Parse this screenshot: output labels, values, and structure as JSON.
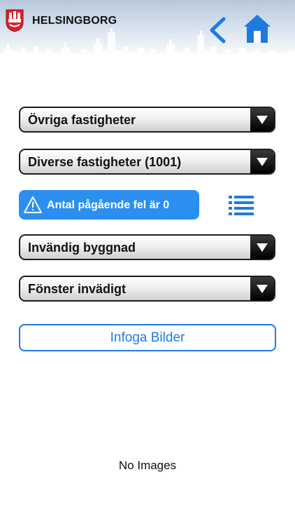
{
  "header": {
    "title": "HELSINGBORG",
    "back_icon": "chevron-left-icon",
    "home_icon": "home-icon",
    "accent_color": "#1f7ae0"
  },
  "selects": [
    {
      "label": "Övriga fastigheter"
    },
    {
      "label": "Diverse fastigheter (1001)"
    },
    {
      "label": "Invändig byggnad"
    },
    {
      "label": "Fönster invädigt"
    }
  ],
  "alert": {
    "text": "Antal pågående fel är 0",
    "icon": "warning-icon",
    "color": "#2b8ff0"
  },
  "list_icon": "list-icon",
  "insert_button": {
    "label": "Infoga Bilder"
  },
  "status": {
    "no_images": "No Images"
  }
}
